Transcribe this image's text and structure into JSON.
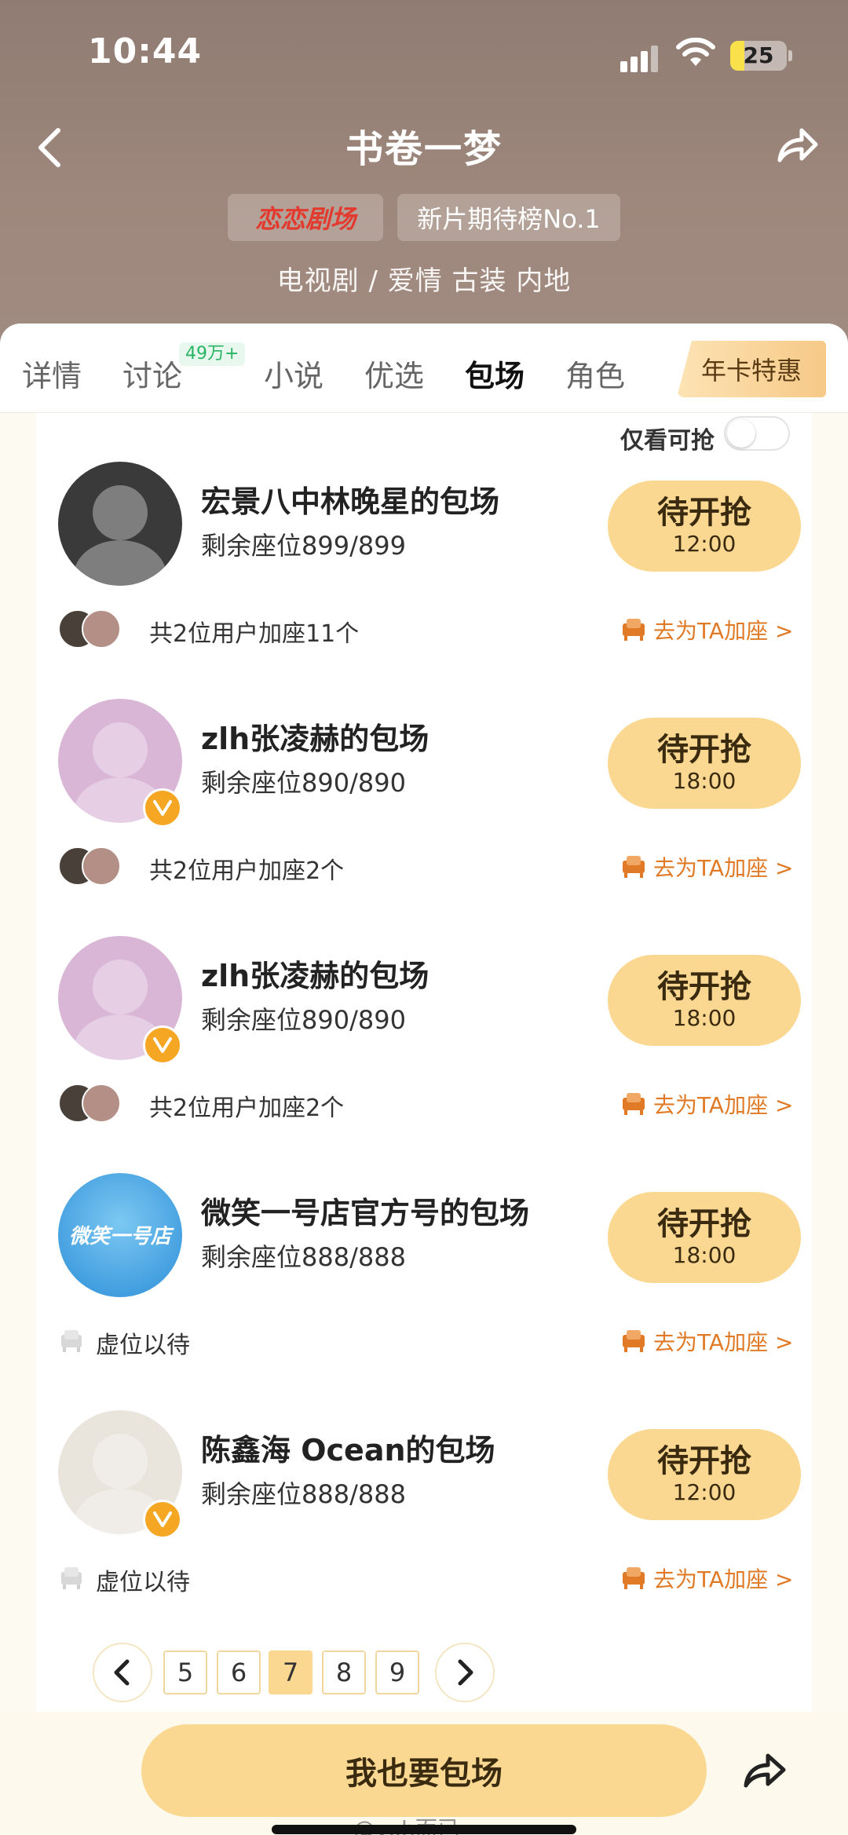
{
  "status_bar": {
    "time": "10:44",
    "battery": "25",
    "battery_level": 0.25
  },
  "header": {
    "title": "书卷一梦",
    "brand_tag": "恋恋剧场",
    "rank_tag": "新片期待榜No.1",
    "genre": "电视剧 / 爱情 古装 内地"
  },
  "tabs": [
    {
      "label": "详情"
    },
    {
      "label": "讨论",
      "badge": "49万+"
    },
    {
      "label": "小说"
    },
    {
      "label": "优选"
    },
    {
      "label": "包场",
      "active": true
    },
    {
      "label": "角色"
    }
  ],
  "promo_tab": "年卡特惠",
  "filter": {
    "label": "仅看可抢",
    "on": false
  },
  "cards": [
    {
      "name": "宏景八中林晚星的包场",
      "seats": "剩余座位899/899",
      "btn_l1": "待开抢",
      "btn_l2": "12:00",
      "joined": "共2位用户加座11个",
      "join_link": "去为TA加座 >",
      "verified": false,
      "vacant": false,
      "avatar_color": "#3a3a3a"
    },
    {
      "name": "zlh张凌赫的包场",
      "seats": "剩余座位890/890",
      "btn_l1": "待开抢",
      "btn_l2": "18:00",
      "joined": "共2位用户加座2个",
      "join_link": "去为TA加座 >",
      "verified": true,
      "vacant": false,
      "avatar_color": "#d9b6d6"
    },
    {
      "name": "zlh张凌赫的包场",
      "seats": "剩余座位890/890",
      "btn_l1": "待开抢",
      "btn_l2": "18:00",
      "joined": "共2位用户加座2个",
      "join_link": "去为TA加座 >",
      "verified": true,
      "vacant": false,
      "avatar_color": "#d9b6d6"
    },
    {
      "name": "微笑一号店官方号的包场",
      "seats": "剩余座位888/888",
      "btn_l1": "待开抢",
      "btn_l2": "18:00",
      "joined": "虚位以待",
      "join_link": "去为TA加座 >",
      "verified": false,
      "vacant": true,
      "avatar_color": "#2d8fd8",
      "avatar_logo": "微笑一号店"
    },
    {
      "name": "陈鑫海 Ocean的包场",
      "seats": "剩余座位888/888",
      "btn_l1": "待开抢",
      "btn_l2": "12:00",
      "joined": "虚位以待",
      "join_link": "去为TA加座 >",
      "verified": true,
      "vacant": true,
      "avatar_color": "#e9e4dc"
    }
  ],
  "pagination": {
    "pages": [
      "5",
      "6",
      "7",
      "8",
      "9"
    ],
    "current": "7"
  },
  "bottom": {
    "cta": "我也要包场",
    "watermark": "@yxh而已"
  },
  "colors": {
    "accent": "#fbd891",
    "link": "#e07a26",
    "brand_red": "#e23a2e"
  }
}
